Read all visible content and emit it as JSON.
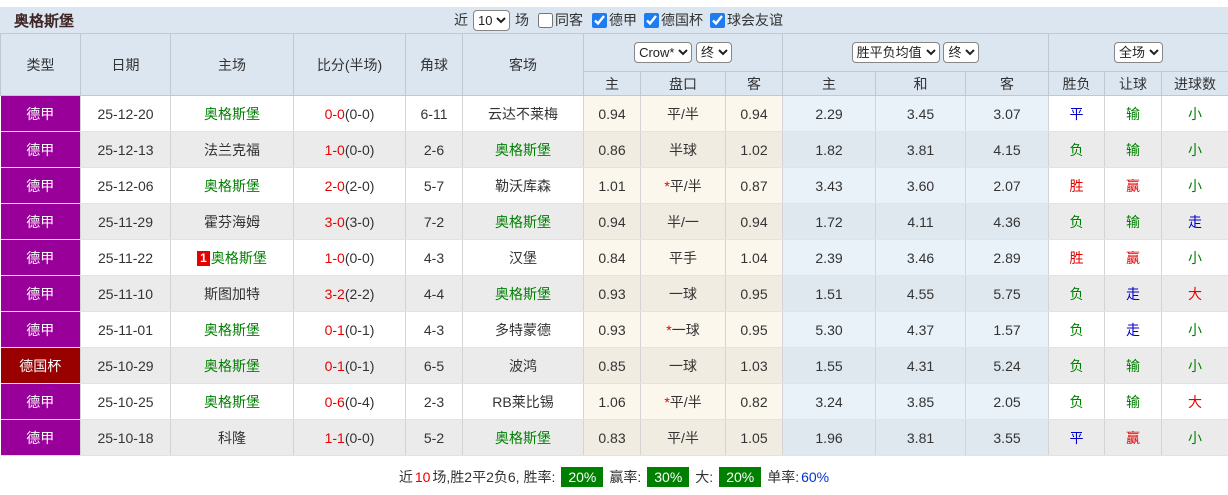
{
  "colors": {
    "league_badge_purple": "#990099",
    "cup_badge_darkred": "#990000",
    "augsburg_green": "#008000",
    "score_red": "#e60000",
    "draw_blue": "#0000cc",
    "header_bg": "#dce6f1",
    "rate_badge_green": "#008000"
  },
  "header": {
    "team_title": "奥格斯堡",
    "near_label": "近",
    "matches_count": "10",
    "matches_label": "场",
    "same_away_label": "同客",
    "filters": [
      {
        "label": "德甲",
        "checked": true
      },
      {
        "label": "德国杯",
        "checked": true
      },
      {
        "label": "球会友谊",
        "checked": true
      }
    ]
  },
  "table": {
    "headers": {
      "type": "类型",
      "date": "日期",
      "home": "主场",
      "score": "比分(半场)",
      "corner": "角球",
      "away": "客场",
      "odds_home": "主",
      "odds_line": "盘口",
      "odds_away": "客",
      "avg_home": "主",
      "avg_draw": "和",
      "avg_away": "客",
      "outcome": "胜负",
      "letgoal": "让球",
      "goals": "进球数"
    },
    "selects": {
      "company": "Crow*",
      "final1": "终",
      "avg": "胜平负均值",
      "final2": "终",
      "scope": "全场"
    },
    "rows": [
      {
        "league": {
          "text": "德甲",
          "cls": "purple"
        },
        "date": "25-12-20",
        "home": {
          "text": "奥格斯堡",
          "green": true,
          "badge": ""
        },
        "score": {
          "ft": "0-0",
          "ht": "(0-0)"
        },
        "corner": "6-11",
        "away": {
          "text": "云达不莱梅",
          "green": false
        },
        "crow": {
          "home": "0.94",
          "line": "平/半",
          "star": false,
          "away": "0.94"
        },
        "avg": {
          "home": "2.29",
          "draw": "3.45",
          "away": "3.07"
        },
        "outcome": {
          "text": "平",
          "cls": "blue"
        },
        "letgoal": {
          "text": "输",
          "cls": "green"
        },
        "goals": {
          "text": "小",
          "cls": "green"
        }
      },
      {
        "league": {
          "text": "德甲",
          "cls": "purple"
        },
        "date": "25-12-13",
        "home": {
          "text": "法兰克福",
          "green": false,
          "badge": ""
        },
        "score": {
          "ft": "1-0",
          "ht": "(0-0)"
        },
        "corner": "2-6",
        "away": {
          "text": "奥格斯堡",
          "green": true
        },
        "crow": {
          "home": "0.86",
          "line": "半球",
          "star": false,
          "away": "1.02"
        },
        "avg": {
          "home": "1.82",
          "draw": "3.81",
          "away": "4.15"
        },
        "outcome": {
          "text": "负",
          "cls": "green"
        },
        "letgoal": {
          "text": "输",
          "cls": "green"
        },
        "goals": {
          "text": "小",
          "cls": "green"
        }
      },
      {
        "league": {
          "text": "德甲",
          "cls": "purple"
        },
        "date": "25-12-06",
        "home": {
          "text": "奥格斯堡",
          "green": true,
          "badge": ""
        },
        "score": {
          "ft": "2-0",
          "ht": "(2-0)"
        },
        "corner": "5-7",
        "away": {
          "text": "勒沃库森",
          "green": false
        },
        "crow": {
          "home": "1.01",
          "line": "平/半",
          "star": true,
          "away": "0.87"
        },
        "avg": {
          "home": "3.43",
          "draw": "3.60",
          "away": "2.07"
        },
        "outcome": {
          "text": "胜",
          "cls": "red"
        },
        "letgoal": {
          "text": "赢",
          "cls": "red"
        },
        "goals": {
          "text": "小",
          "cls": "green"
        }
      },
      {
        "league": {
          "text": "德甲",
          "cls": "purple"
        },
        "date": "25-11-29",
        "home": {
          "text": "霍芬海姆",
          "green": false,
          "badge": ""
        },
        "score": {
          "ft": "3-0",
          "ht": "(3-0)"
        },
        "corner": "7-2",
        "away": {
          "text": "奥格斯堡",
          "green": true
        },
        "crow": {
          "home": "0.94",
          "line": "半/一",
          "star": false,
          "away": "0.94"
        },
        "avg": {
          "home": "1.72",
          "draw": "4.11",
          "away": "4.36"
        },
        "outcome": {
          "text": "负",
          "cls": "green"
        },
        "letgoal": {
          "text": "输",
          "cls": "green"
        },
        "goals": {
          "text": "走",
          "cls": "blue"
        }
      },
      {
        "league": {
          "text": "德甲",
          "cls": "purple"
        },
        "date": "25-11-22",
        "home": {
          "text": "奥格斯堡",
          "green": true,
          "badge": "1"
        },
        "score": {
          "ft": "1-0",
          "ht": "(0-0)"
        },
        "corner": "4-3",
        "away": {
          "text": "汉堡",
          "green": false
        },
        "crow": {
          "home": "0.84",
          "line": "平手",
          "star": false,
          "away": "1.04"
        },
        "avg": {
          "home": "2.39",
          "draw": "3.46",
          "away": "2.89"
        },
        "outcome": {
          "text": "胜",
          "cls": "red"
        },
        "letgoal": {
          "text": "赢",
          "cls": "red"
        },
        "goals": {
          "text": "小",
          "cls": "green"
        }
      },
      {
        "league": {
          "text": "德甲",
          "cls": "purple"
        },
        "date": "25-11-10",
        "home": {
          "text": "斯图加特",
          "green": false,
          "badge": ""
        },
        "score": {
          "ft": "3-2",
          "ht": "(2-2)"
        },
        "corner": "4-4",
        "away": {
          "text": "奥格斯堡",
          "green": true
        },
        "crow": {
          "home": "0.93",
          "line": "一球",
          "star": false,
          "away": "0.95"
        },
        "avg": {
          "home": "1.51",
          "draw": "4.55",
          "away": "5.75"
        },
        "outcome": {
          "text": "负",
          "cls": "green"
        },
        "letgoal": {
          "text": "走",
          "cls": "blue"
        },
        "goals": {
          "text": "大",
          "cls": "red"
        }
      },
      {
        "league": {
          "text": "德甲",
          "cls": "purple"
        },
        "date": "25-11-01",
        "home": {
          "text": "奥格斯堡",
          "green": true,
          "badge": ""
        },
        "score": {
          "ft": "0-1",
          "ht": "(0-1)"
        },
        "corner": "4-3",
        "away": {
          "text": "多特蒙德",
          "green": false
        },
        "crow": {
          "home": "0.93",
          "line": "一球",
          "star": true,
          "away": "0.95"
        },
        "avg": {
          "home": "5.30",
          "draw": "4.37",
          "away": "1.57"
        },
        "outcome": {
          "text": "负",
          "cls": "green"
        },
        "letgoal": {
          "text": "走",
          "cls": "blue"
        },
        "goals": {
          "text": "小",
          "cls": "green"
        }
      },
      {
        "league": {
          "text": "德国杯",
          "cls": "darkred"
        },
        "date": "25-10-29",
        "home": {
          "text": "奥格斯堡",
          "green": true,
          "badge": ""
        },
        "score": {
          "ft": "0-1",
          "ht": "(0-1)"
        },
        "corner": "6-5",
        "away": {
          "text": "波鸿",
          "green": false
        },
        "crow": {
          "home": "0.85",
          "line": "一球",
          "star": false,
          "away": "1.03"
        },
        "avg": {
          "home": "1.55",
          "draw": "4.31",
          "away": "5.24"
        },
        "outcome": {
          "text": "负",
          "cls": "green"
        },
        "letgoal": {
          "text": "输",
          "cls": "green"
        },
        "goals": {
          "text": "小",
          "cls": "green"
        }
      },
      {
        "league": {
          "text": "德甲",
          "cls": "purple"
        },
        "date": "25-10-25",
        "home": {
          "text": "奥格斯堡",
          "green": true,
          "badge": ""
        },
        "score": {
          "ft": "0-6",
          "ht": "(0-4)"
        },
        "corner": "2-3",
        "away": {
          "text": "RB莱比锡",
          "green": false
        },
        "crow": {
          "home": "1.06",
          "line": "平/半",
          "star": true,
          "away": "0.82"
        },
        "avg": {
          "home": "3.24",
          "draw": "3.85",
          "away": "2.05"
        },
        "outcome": {
          "text": "负",
          "cls": "green"
        },
        "letgoal": {
          "text": "输",
          "cls": "green"
        },
        "goals": {
          "text": "大",
          "cls": "red"
        }
      },
      {
        "league": {
          "text": "德甲",
          "cls": "purple"
        },
        "date": "25-10-18",
        "home": {
          "text": "科隆",
          "green": false,
          "badge": ""
        },
        "score": {
          "ft": "1-1",
          "ht": "(0-0)"
        },
        "corner": "5-2",
        "away": {
          "text": "奥格斯堡",
          "green": true
        },
        "crow": {
          "home": "0.83",
          "line": "平/半",
          "star": false,
          "away": "1.05"
        },
        "avg": {
          "home": "1.96",
          "draw": "3.81",
          "away": "3.55"
        },
        "outcome": {
          "text": "平",
          "cls": "blue"
        },
        "letgoal": {
          "text": "赢",
          "cls": "red"
        },
        "goals": {
          "text": "小",
          "cls": "green"
        }
      }
    ]
  },
  "footer": {
    "near": "近",
    "count": "10",
    "record": "场,胜2平2负6, 胜率:",
    "win_rate": "20%",
    "odds_win_label": "赢率:",
    "odds_win_rate": "30%",
    "big_label": "大:",
    "big_rate": "20%",
    "single_label": "单率:",
    "single_rate": "60%"
  }
}
